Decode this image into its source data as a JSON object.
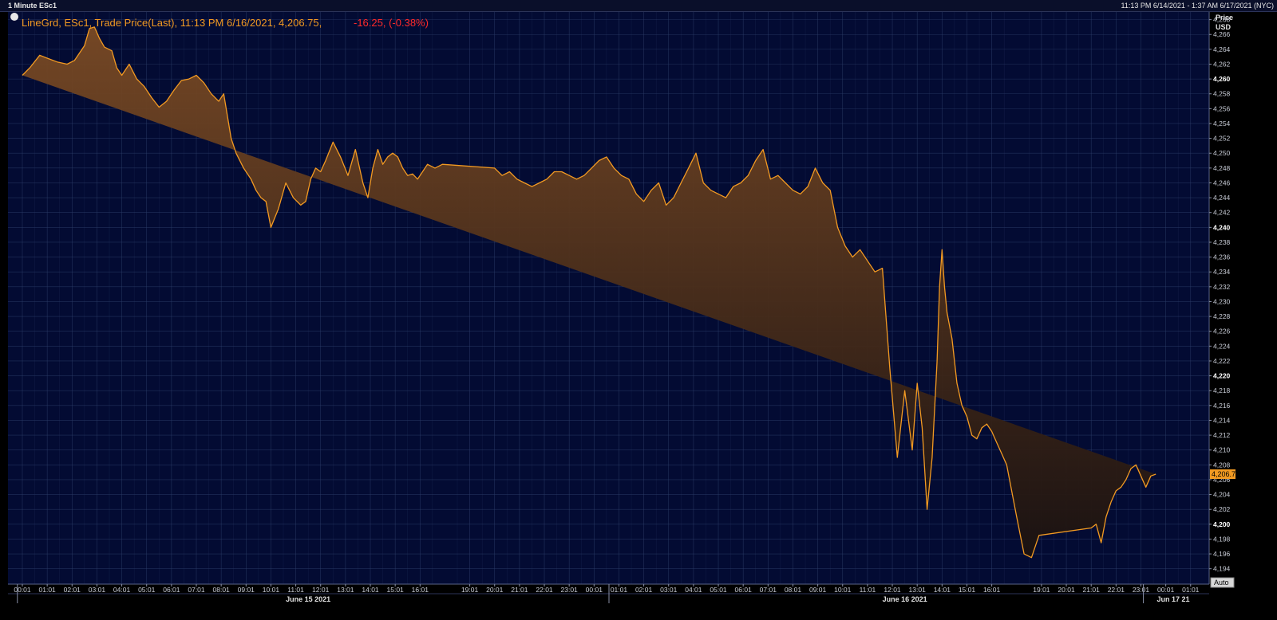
{
  "window": {
    "title": "1 Minute ESc1",
    "range": "11:13 PM 6/14/2021 - 1:37 AM 6/17/2021 (NYC)"
  },
  "legend": {
    "series": "LineGrd, ESc1, Trade Price(Last), 11:13 PM 6/16/2021, 4,206.75,",
    "change": "-16.25, (-0.38%)"
  },
  "colors": {
    "background": "#030b33",
    "line": "#f29a22",
    "change": "#ff2a2a",
    "grid": "#2e3f6a",
    "area_top": "#7a4a24",
    "area_bottom": "#1b1210"
  },
  "chart_data": {
    "type": "area",
    "title": "LineGrd, ESc1, Trade Price(Last), 11:13 PM 6/16/2021, 4,206.75, -16.25, (-0.38%)",
    "ylabel": "Price USD",
    "y_axis_title": [
      "Price",
      "USD"
    ],
    "currency": "USD",
    "last_price_label": "4,206.75",
    "ylim": [
      4193,
      4270
    ],
    "y_ticks": [
      "4,194",
      "4,196",
      "4,198",
      "4,200",
      "4,202",
      "4,204",
      "4,206",
      "4,208",
      "4,210",
      "4,212",
      "4,214",
      "4,216",
      "4,218",
      "4,220",
      "4,222",
      "4,224",
      "4,226",
      "4,228",
      "4,230",
      "4,232",
      "4,234",
      "4,236",
      "4,238",
      "4,240",
      "4,242",
      "4,244",
      "4,246",
      "4,248",
      "4,250",
      "4,252",
      "4,254",
      "4,256",
      "4,258",
      "4,260",
      "4,262",
      "4,264",
      "4,266",
      "4,268"
    ],
    "y_bold_ticks": [
      "4,200",
      "4,220",
      "4,240",
      "4,260"
    ],
    "x_ticks": [
      "00:01",
      "01:01",
      "02:01",
      "03:01",
      "04:01",
      "05:01",
      "06:01",
      "07:01",
      "08:01",
      "09:01",
      "10:01",
      "11:01",
      "12:01",
      "13:01",
      "14:01",
      "15:01",
      "16:01",
      "19:01",
      "20:01",
      "21:01",
      "22:01",
      "23:01",
      "00:01",
      "01:01",
      "02:01",
      "03:01",
      "04:01",
      "05:01",
      "06:01",
      "07:01",
      "08:01",
      "09:01",
      "10:01",
      "11:01",
      "12:01",
      "13:01",
      "14:01",
      "15:01",
      "16:01",
      "19:01",
      "20:01",
      "21:01",
      "22:01",
      "23:01",
      "00:01",
      "01:01"
    ],
    "date_labels": [
      "June 15 2021",
      "June 16 2021",
      "Jun 17 21"
    ],
    "auto_label": "Auto",
    "grid": true,
    "series": [
      {
        "name": "ESc1",
        "x_hours": [
          0,
          0.3,
          0.7,
          1.0,
          1.4,
          1.8,
          2.1,
          2.5,
          2.7,
          2.9,
          3.1,
          3.3,
          3.6,
          3.8,
          4.0,
          4.3,
          4.6,
          4.9,
          5.2,
          5.5,
          5.8,
          6.1,
          6.4,
          6.7,
          7.0,
          7.3,
          7.6,
          7.9,
          8.1,
          8.4,
          8.6,
          8.9,
          9.2,
          9.4,
          9.6,
          9.8,
          10.0,
          10.3,
          10.6,
          10.9,
          11.2,
          11.4,
          11.6,
          11.8,
          12.0,
          12.2,
          12.5,
          12.8,
          13.1,
          13.4,
          13.7,
          13.9,
          14.1,
          14.3,
          14.5,
          14.7,
          14.9,
          15.1,
          15.3,
          15.5,
          15.7,
          15.9,
          16.1,
          16.3,
          16.6,
          16.9,
          19.0,
          19.3,
          19.6,
          19.9,
          20.2,
          20.5,
          20.8,
          21.1,
          21.4,
          21.7,
          22.0,
          22.3,
          22.6,
          22.9,
          23.2,
          23.5,
          23.8,
          24.1,
          24.4,
          24.7,
          25.0,
          25.3,
          25.6,
          25.9,
          26.2,
          26.5,
          26.8,
          27.1,
          27.4,
          27.7,
          28.0,
          28.3,
          28.6,
          28.9,
          29.2,
          29.5,
          29.8,
          30.1,
          30.4,
          30.7,
          31.0,
          31.3,
          31.6,
          31.9,
          32.2,
          32.5,
          32.8,
          33.1,
          33.4,
          33.7,
          34.0,
          34.3,
          34.6,
          34.9,
          35.2,
          35.5,
          35.8,
          36.0,
          36.2,
          36.4,
          36.6,
          36.8,
          36.9,
          37.0,
          37.1,
          37.2,
          37.4,
          37.6,
          37.8,
          38.0,
          38.2,
          38.4,
          38.6,
          38.8,
          39.0,
          39.2,
          39.4,
          39.6,
          40.0,
          40.3,
          40.6,
          40.9,
          43.0,
          43.2,
          43.4,
          43.6,
          43.8,
          44.0,
          44.2,
          44.4,
          44.6,
          44.8,
          45.0,
          45.2,
          45.4,
          45.6,
          45.8,
          46.0,
          46.2
        ],
        "values": [
          4260.5,
          4261.5,
          4263.2,
          4262.8,
          4262.3,
          4262.0,
          4262.5,
          4264.5,
          4266.8,
          4267.0,
          4265.5,
          4264.3,
          4263.8,
          4261.5,
          4260.5,
          4262.0,
          4260.0,
          4259.0,
          4257.5,
          4256.2,
          4257.0,
          4258.5,
          4259.8,
          4260.0,
          4260.5,
          4259.5,
          4258.0,
          4257.0,
          4258.0,
          4252.0,
          4250.0,
          4248.0,
          4246.5,
          4245.0,
          4244.0,
          4243.5,
          4240.0,
          4242.5,
          4246.0,
          4244.0,
          4243.0,
          4243.5,
          4246.5,
          4248.0,
          4247.5,
          4249.0,
          4251.5,
          4249.5,
          4247.0,
          4250.5,
          4246.0,
          4244.0,
          4248.0,
          4250.5,
          4248.5,
          4249.5,
          4250.0,
          4249.5,
          4248.0,
          4247.0,
          4247.2,
          4246.5,
          4247.5,
          4248.5,
          4248.0,
          4248.5,
          4248.0,
          4247.0,
          4247.5,
          4246.5,
          4246.0,
          4245.5,
          4246.0,
          4246.5,
          4247.5,
          4247.5,
          4247.0,
          4246.5,
          4247.0,
          4248.0,
          4249.0,
          4249.5,
          4248.0,
          4247.0,
          4246.5,
          4244.5,
          4243.5,
          4245.0,
          4246.0,
          4243.0,
          4244.0,
          4246.0,
          4248.0,
          4250.0,
          4246.0,
          4245.0,
          4244.5,
          4244.0,
          4245.5,
          4246.0,
          4247.0,
          4249.0,
          4250.5,
          4246.5,
          4247.0,
          4246.0,
          4245.0,
          4244.5,
          4245.5,
          4248.0,
          4246.0,
          4245.0,
          4240.0,
          4237.5,
          4236.0,
          4237.0,
          4235.5,
          4234.0,
          4234.5,
          4221.0,
          4209.0,
          4218.0,
          4210.0,
          4219.0,
          4213.0,
          4202.0,
          4209.0,
          4222.0,
          4232.0,
          4237.0,
          4232.0,
          4228.5,
          4225.0,
          4219.0,
          4216.0,
          4214.5,
          4212.0,
          4211.5,
          4213.0,
          4213.5,
          4212.5,
          4211.0,
          4209.5,
          4208.0,
          4201.0,
          4196.0,
          4195.5,
          4198.5,
          4199.5,
          4200.0,
          4197.5,
          4201.0,
          4203.0,
          4204.5,
          4205.0,
          4206.0,
          4207.5,
          4208.0,
          4206.5,
          4205.0,
          4206.5,
          4206.75
        ]
      }
    ]
  }
}
